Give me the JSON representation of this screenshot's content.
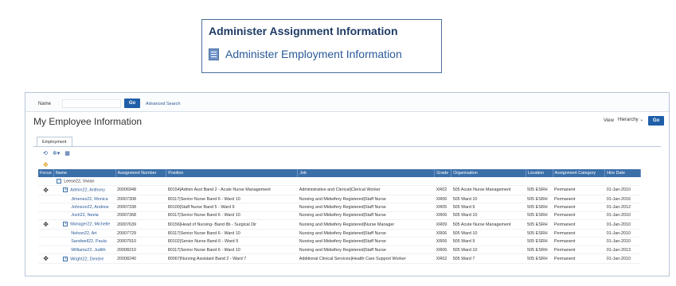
{
  "callout": {
    "title": "Administer Assignment Information",
    "link": "Administer Employment Information"
  },
  "search": {
    "label": "Name",
    "value": "",
    "go": "Go",
    "advanced": "Advanced Search"
  },
  "page": {
    "title": "My Employee Information",
    "view_label": "View",
    "view_value": "Hierarchy",
    "go": "Go"
  },
  "tabs": [
    "Employment"
  ],
  "columns": [
    "Focus",
    "Name",
    "Assignment Number",
    "Position",
    "Job",
    "Grade",
    "Organisation",
    "Location",
    "Assignment Category",
    "Hire Date"
  ],
  "root": {
    "name": "Leese22, Vivian"
  },
  "rows": [
    {
      "focus": true,
      "exp": true,
      "indent": 1,
      "name": "Admin22, Anthony",
      "num": "20006948",
      "pos": "80154|Admin Asst Band 2 - Acute Nurse Management",
      "job": "Administrative and Clerical|Clerical Worker",
      "grade": "XR02",
      "org": "505 Acute Nurse Management",
      "loc": "505 ESRH",
      "cat": "Permanent",
      "hire": "01-Jan-2010"
    },
    {
      "focus": false,
      "exp": false,
      "indent": 2,
      "name": "Jimenes22, Monica",
      "num": "20007308",
      "pos": "80117|Senior Nurse Band 6 - Ward 10",
      "job": "Nursing and Midwifery Registered|Staff Nurse",
      "grade": "XR06",
      "org": "505 Ward 10",
      "loc": "505 ESRH",
      "cat": "Permanent",
      "hire": "01-Jan-2016"
    },
    {
      "focus": false,
      "exp": false,
      "indent": 2,
      "name": "Johnson22, Andrew",
      "num": "20007338",
      "pos": "80100|Staff Nurse Band 5 - Ward 9",
      "job": "Nursing and Midwifery Registered|Staff Nurse",
      "grade": "XR05",
      "org": "505 Ward 9",
      "loc": "505 ESRH",
      "cat": "Permanent",
      "hire": "01-Jan-2012"
    },
    {
      "focus": false,
      "exp": false,
      "indent": 2,
      "name": "Josh22, Neela",
      "num": "20007368",
      "pos": "80117|Senior Nurse Band 6 - Ward 10",
      "job": "Nursing and Midwifery Registered|Staff Nurse",
      "grade": "XR06",
      "org": "505 Ward 10",
      "loc": "505 ESRH",
      "cat": "Permanent",
      "hire": "01-Jan-2010"
    },
    {
      "focus": true,
      "exp": true,
      "indent": 1,
      "name": "Manager22, Michelle",
      "num": "20007639",
      "pos": "80156|Head of Nursing- Band 8b - Surgical Dir",
      "job": "Nursing and Midwifery Registered|Nurse Manager",
      "grade": "XR09",
      "org": "505 Acute Nurse Management",
      "loc": "505 ESRH",
      "cat": "Permanent",
      "hire": "01-Jan-2010"
    },
    {
      "focus": false,
      "exp": false,
      "indent": 2,
      "name": "Nelson22, Art",
      "num": "20007729",
      "pos": "80117|Senior Nurse Band 6 - Ward 10",
      "job": "Nursing and Midwifery Registered|Staff Nurse",
      "grade": "XR06",
      "org": "505 Ward 10",
      "loc": "505 ESRH",
      "cat": "Permanent",
      "hire": "01-Jan-2010"
    },
    {
      "focus": false,
      "exp": false,
      "indent": 2,
      "name": "Sandwell22, Paula",
      "num": "20007910",
      "pos": "80102|Senior Nurse Band 6 - Ward 9",
      "job": "Nursing and Midwifery Registered|Staff Nurse",
      "grade": "XR06",
      "org": "505 Ward 9",
      "loc": "505 ESRH",
      "cat": "Permanent",
      "hire": "01-Jan-2010"
    },
    {
      "focus": false,
      "exp": false,
      "indent": 2,
      "name": "Williams22, Judith",
      "num": "20008210",
      "pos": "80117|Senior Nurse Band 6 - Ward 10",
      "job": "Nursing and Midwifery Registered|Staff Nurse",
      "grade": "XR06",
      "org": "505 Ward 10",
      "loc": "505 ESRH",
      "cat": "Permanent",
      "hire": "01-Jan-2013"
    },
    {
      "focus": true,
      "exp": true,
      "indent": 1,
      "name": "Wright22, Deirdre",
      "num": "20008240",
      "pos": "80067|Nursing Assistant Band 2 - Ward 7",
      "job": "Additional Clinical Services|Health Care Support Worker",
      "grade": "XR02",
      "org": "505 Ward 7",
      "loc": "505 ESRH",
      "cat": "Permanent",
      "hire": "01-Jan-2010"
    }
  ]
}
